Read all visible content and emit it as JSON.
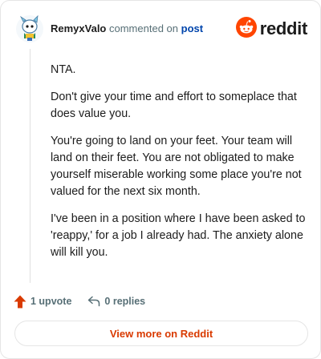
{
  "comment": {
    "username": "RemyxValo",
    "verb": "commented on",
    "target_link": "post",
    "paragraphs": [
      "NTA.",
      "Don't give your time and effort to someplace that does value you.",
      "You're going to land on your feet. Your team will land on their feet. You are not obligated to make yourself miserable working some place you're not valued for the next six month.",
      "I've been in a position where I have been asked to 'reappy,' for a job I already had. The anxiety alone will kill you."
    ]
  },
  "brand": {
    "wordmark": "reddit",
    "color": "#ff4500"
  },
  "actions": {
    "upvote_label": "1 upvote",
    "replies_label": "0 replies"
  },
  "footer": {
    "view_more_label": "View more on Reddit"
  },
  "colors": {
    "accent": "#d93a00",
    "link": "#0045ac",
    "upvote": "#d93a00",
    "muted": "#576f76"
  },
  "icons": [
    "avatar",
    "reddit-logo-icon",
    "upvote-arrow-icon",
    "reply-icon"
  ]
}
